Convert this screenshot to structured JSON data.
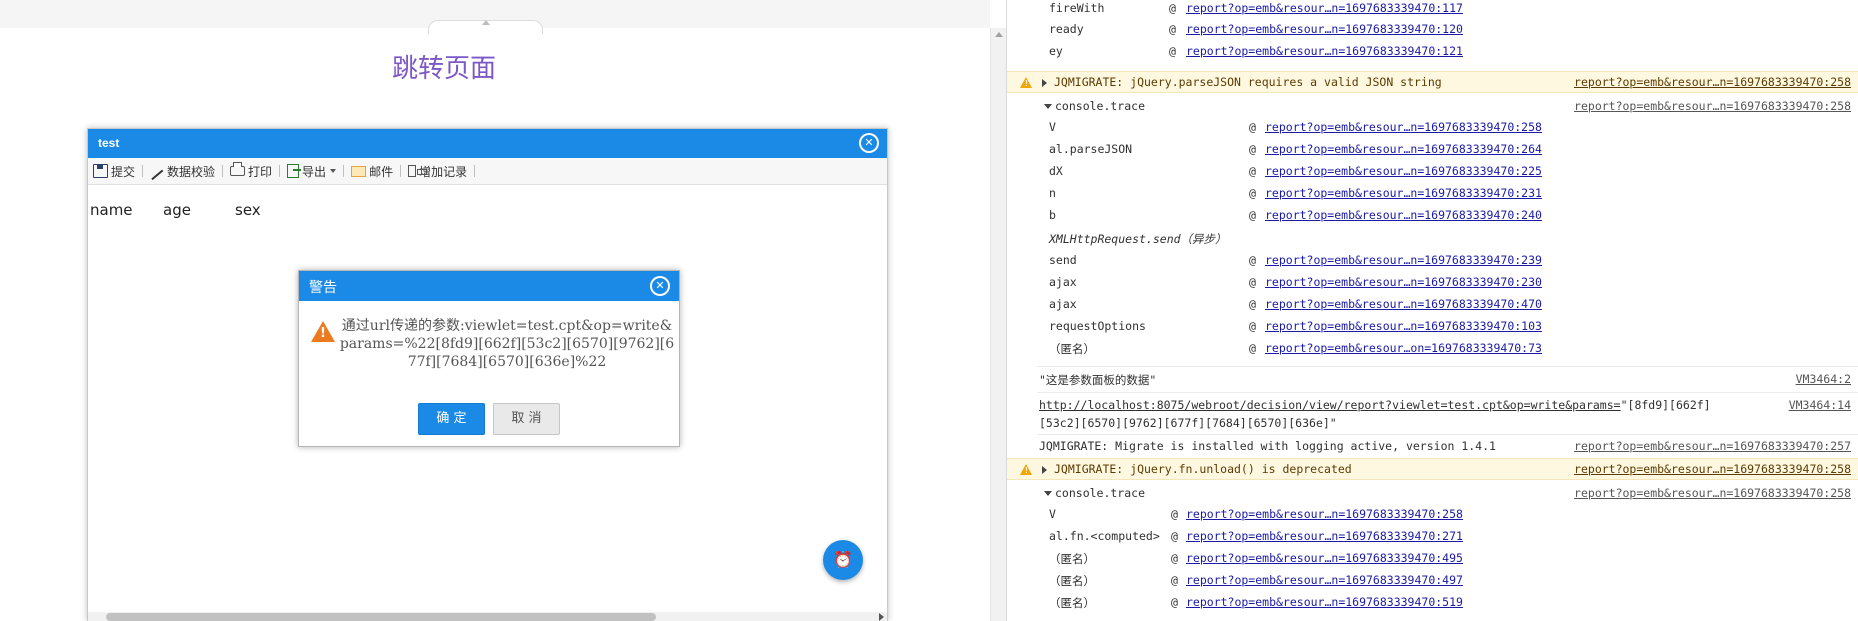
{
  "page": {
    "title": "跳转页面"
  },
  "report": {
    "title": "test",
    "toolbar": [
      {
        "label": "提交",
        "icon": "save-icon"
      },
      {
        "label": "数据校验",
        "icon": "check-icon"
      },
      {
        "label": "打印",
        "icon": "print-icon"
      },
      {
        "label": "导出",
        "icon": "export-icon"
      },
      {
        "label": "邮件",
        "icon": "mail-icon"
      },
      {
        "label": "增加记录",
        "icon": "add-row-icon"
      }
    ],
    "columns": [
      "name",
      "age",
      "sex"
    ]
  },
  "alert": {
    "title": "警告",
    "message": "通过url传递的参数:viewlet=test.cpt&op=write&params=%22[8fd9][662f][53c2][6570][9762][677f][7684][6570][636e]%22",
    "ok_label": "确 定",
    "cancel_label": "取 消"
  },
  "console": {
    "stack1": [
      {
        "fn": "fireWith",
        "link": "report?op=emb&resour…n=1697683339470:117"
      },
      {
        "fn": "ready",
        "link": "report?op=emb&resour…n=1697683339470:120"
      },
      {
        "fn": "ey",
        "link": "report?op=emb&resour…n=1697683339470:121"
      }
    ],
    "warn1": {
      "text": "JQMIGRATE: jQuery.parseJSON requires a valid JSON string",
      "src": "report?op=emb&resour…n=1697683339470:258"
    },
    "trace1": {
      "label": "console.trace",
      "src": "report?op=emb&resour…n=1697683339470:258"
    },
    "stack2": [
      {
        "fn": "V",
        "link": "report?op=emb&resour…n=1697683339470:258"
      },
      {
        "fn": "al.parseJSON",
        "link": "report?op=emb&resour…n=1697683339470:264"
      },
      {
        "fn": "dX",
        "link": "report?op=emb&resour…n=1697683339470:225"
      },
      {
        "fn": "n",
        "link": "report?op=emb&resour…n=1697683339470:231"
      },
      {
        "fn": "b",
        "link": "report?op=emb&resour…n=1697683339470:240"
      }
    ],
    "async_label": "XMLHttpRequest.send（异步）",
    "stack3": [
      {
        "fn": "send",
        "link": "report?op=emb&resour…n=1697683339470:239"
      },
      {
        "fn": "ajax",
        "link": "report?op=emb&resour…n=1697683339470:230"
      },
      {
        "fn": "ajax",
        "link": "report?op=emb&resour…n=1697683339470:470"
      },
      {
        "fn": "requestOptions",
        "link": "report?op=emb&resour…n=1697683339470:103"
      },
      {
        "fn": "（匿名）",
        "link": "report?op=emb&resour…on=1697683339470:73"
      }
    ],
    "log1": {
      "text": "\"这是参数面板的数据\"",
      "src": "VM3464:2"
    },
    "log2": {
      "url": "http://localhost:8075/webroot/decision/view/report?viewlet=test.cpt&op=write&params=",
      "rest1": "\"[8fd9][662f]",
      "rest2": "[53c2][6570][9762][677f][7684][6570][636e]\"",
      "src": "VM3464:14"
    },
    "log3": {
      "text": "JQMIGRATE: Migrate is installed with logging active, version 1.4.1",
      "src": "report?op=emb&resour…n=1697683339470:257"
    },
    "warn2": {
      "text": "JQMIGRATE: jQuery.fn.unload() is deprecated",
      "src": "report?op=emb&resour…n=1697683339470:258"
    },
    "trace2": {
      "label": "console.trace",
      "src": "report?op=emb&resour…n=1697683339470:258"
    },
    "stack4": [
      {
        "fn": "V",
        "link": "report?op=emb&resour…n=1697683339470:258"
      },
      {
        "fn": "al.fn.<computed>",
        "link": "report?op=emb&resour…n=1697683339470:271"
      },
      {
        "fn": "（匿名）",
        "link": "report?op=emb&resour…n=1697683339470:495"
      },
      {
        "fn": "（匿名）",
        "link": "report?op=emb&resour…n=1697683339470:497"
      },
      {
        "fn": "（匿名）",
        "link": "report?op=emb&resour…n=1697683339470:519"
      }
    ]
  }
}
